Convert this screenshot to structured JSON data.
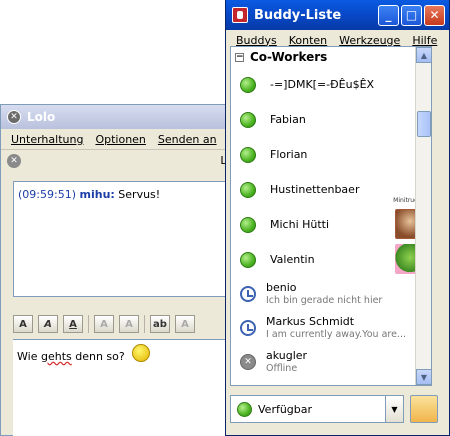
{
  "chat_window": {
    "title": "Lolo",
    "menu": [
      "Unterhaltung",
      "Optionen",
      "Senden an"
    ],
    "tab_label": "Lo",
    "history": {
      "timestamp": "(09:59:51)",
      "sender": "mihu:",
      "message": "Servus!"
    },
    "toolbar_buttons": [
      "A",
      "A",
      "A",
      "A",
      "A",
      "ab",
      "A"
    ],
    "input_text_before": "Wie ",
    "input_text_misspelled": "gehts",
    "input_text_after": " denn so?",
    "smiley": "smiley-icon"
  },
  "buddy_window": {
    "title": "Buddy-Liste",
    "window_buttons": [
      "_",
      "□",
      "✕"
    ],
    "menu": [
      "Buddys",
      "Konten",
      "Werkzeuge",
      "Hilfe"
    ],
    "group_name": "Co-Workers",
    "buddies": [
      {
        "name": "-=]DMK[=-ĐÊu$ÊX",
        "status": "online"
      },
      {
        "name": "Fabian",
        "status": "online"
      },
      {
        "name": "Florian",
        "status": "online"
      },
      {
        "name": "Hustinettenbaer",
        "status": "online",
        "avatar_text": "Minitrucker"
      },
      {
        "name": "Michi Hütti",
        "status": "online",
        "avatar": "monkey"
      },
      {
        "name": "Valentin",
        "status": "online",
        "avatar": "frog"
      },
      {
        "name": "benio",
        "status": "away",
        "message": "Ich bin gerade nicht hier"
      },
      {
        "name": "Markus Schmidt",
        "status": "away",
        "message": "I am currently away.You are..."
      },
      {
        "name": "akugler",
        "status": "offline",
        "message": "Offline"
      }
    ],
    "status_selector": "Verfügbar",
    "colors": {
      "online": "#4bb321",
      "away": "#3c62b3",
      "offline": "#8a8a8a",
      "titlebar": "#0848c7"
    }
  }
}
